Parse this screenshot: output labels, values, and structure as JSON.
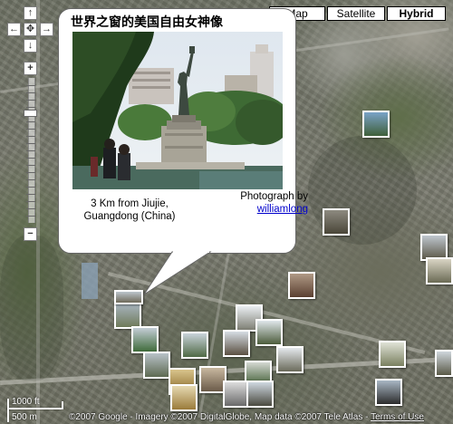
{
  "map_type": {
    "map_label": "Map",
    "satellite_label": "Satellite",
    "hybrid_label": "Hybrid",
    "active": "Hybrid"
  },
  "navigation": {
    "pan_up": "↑",
    "pan_left": "←",
    "pan_center": "✥",
    "pan_right": "→",
    "pan_down": "↓",
    "zoom_in": "+",
    "zoom_out": "−"
  },
  "info_window": {
    "title": "世界之窗的美国自由女神像",
    "caption": "3 Km from Jiujie, Guangdong (China)",
    "credit_prefix": "Photograph by",
    "author": "williamlong"
  },
  "scale": {
    "feet": "1000 ft",
    "meters": "500 m"
  },
  "footer": {
    "copyright": "©2007 Google - Imagery ©2007 DigitalGlobe, Map data ©2007 Tele Atlas -",
    "terms": "Terms of Use"
  }
}
